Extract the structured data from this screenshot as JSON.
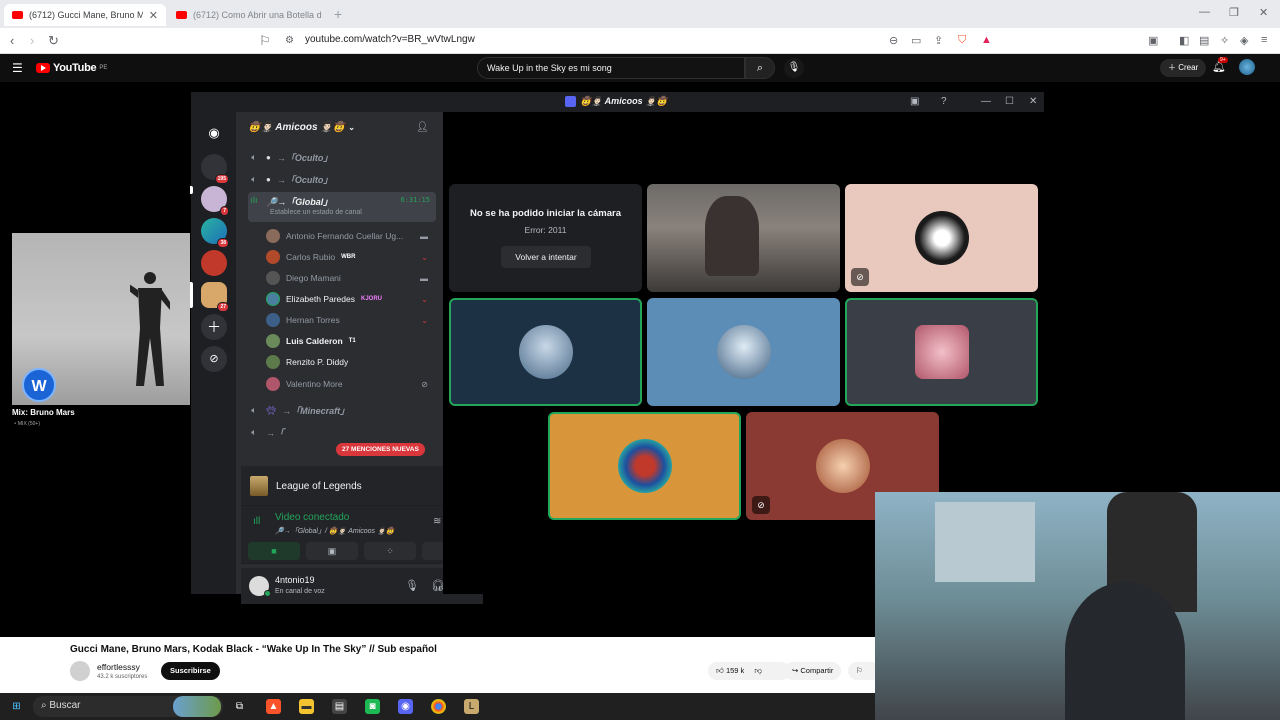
{
  "browser": {
    "tabs": [
      {
        "title": "(6712) Gucci Mane, Bruno Mars,",
        "active": true
      },
      {
        "title": "(6712) Como Abrir una Botella de vin",
        "active": false
      }
    ],
    "url": "youtube.com/watch?v=BR_wVtwLngw"
  },
  "youtube": {
    "logo_text": "YouTube",
    "region": "PE",
    "search_query": "Wake Up in the Sky es mi song",
    "create_label": "Crear",
    "notif_badge": "9+",
    "mini_title": "Mix: Bruno Mars",
    "mini_sub": "MIX (50+)",
    "video_title": "Gucci Mane, Bruno Mars, Kodak Black - “Wake Up In The Sky” // Sub español",
    "channel_name": "effortlesssy",
    "channel_subs": "43.2 k suscriptores",
    "subscribe_label": "Suscribirse",
    "likes": "159 k",
    "share_label": "Compartir",
    "save_label": "Gu"
  },
  "discord": {
    "window_title": "🤠🤵🏻‍♂️ Amicoos 🤵🏻‍♂️🤠",
    "server_name": "🤠🤵🏻‍♂️ Amicoos 🤵🏻‍♂️🤠",
    "server_badges": [
      "195",
      "7",
      "38",
      "27"
    ],
    "channels_top": [
      {
        "name": "→「Oculto」"
      },
      {
        "name": "→「Oculto」"
      }
    ],
    "active_channel": {
      "name": "🔎→「Global」",
      "timer": "6:31:15",
      "status": "Establece un estado de canal"
    },
    "members": [
      {
        "name": "Antonio Fernando Cuellar Ug...",
        "tag": "",
        "color": "#8a6b5b"
      },
      {
        "name": "Carlos Rubio",
        "tag": "WBR",
        "color": "#b04a2a"
      },
      {
        "name": "Diego Mamani",
        "tag": "",
        "color": "#555555"
      },
      {
        "name": "Elizabeth Paredes",
        "tag": "KJORU",
        "color": "#4a7fa0"
      },
      {
        "name": "Hernan Torres",
        "tag": "",
        "color": "#3c5f88"
      },
      {
        "name": "Luis Calderon",
        "tag": "T1",
        "color": "#6a8a5a"
      },
      {
        "name": "Renzito P. Diddy",
        "tag": "",
        "color": "#5c7a4a"
      },
      {
        "name": "Valentino More",
        "tag": "",
        "color": "#b0566a"
      }
    ],
    "channels_bottom": [
      {
        "name": "→「Minecraft」"
      },
      {
        "name": "→「"
      }
    ],
    "mentions_label": "27 MENCIONES NUEVAS",
    "activity": "League of Legends",
    "voice_status": "Video conectado",
    "voice_path": "🔎→「Global」/ 🤠🤵🏻‍♂️ Amicoos 🤵🏻‍♂️🤠",
    "username": "4ntonio19",
    "user_status": "En canal de voz",
    "camera_error_title": "No se ha podido iniciar la cámara",
    "camera_error_code": "Error: 2011",
    "retry_label": "Volver a intentar"
  },
  "taskbar": {
    "search_placeholder": "Buscar"
  },
  "colors": {
    "youtube_red": "#ff0000",
    "discord_green": "#23a55a",
    "mention_red": "#da373c"
  }
}
